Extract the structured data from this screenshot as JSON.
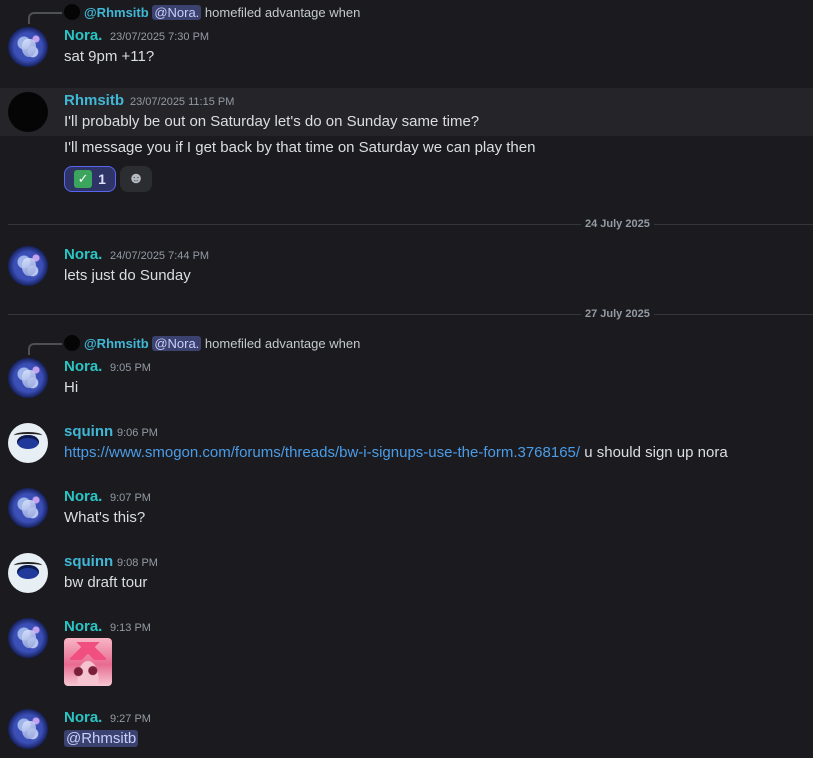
{
  "messages": {
    "m1": {
      "reply_user": "@Rhmsitb",
      "reply_mention": "@Nora.",
      "reply_text": " homefiled advantage when",
      "author": "Nora.",
      "time": "23/07/2025 7:30 PM",
      "text": "sat 9pm +11?"
    },
    "m2": {
      "author": "Rhmsitb",
      "time": "23/07/2025 11:15 PM",
      "line1": "I'll probably be out on Saturday let's do on Sunday same time?",
      "line2": "I'll message you if I get back by that time on Saturday we can play then",
      "reaction_emoji": "✓",
      "reaction_count": "1",
      "add_reaction_icon": "smiley-add-icon"
    },
    "divider1": "24 July 2025",
    "m3": {
      "author": "Nora.",
      "time": "24/07/2025 7:44 PM",
      "text": "lets just do Sunday"
    },
    "divider2": "27 July 2025",
    "m4": {
      "reply_user": "@Rhmsitb",
      "reply_mention": "@Nora.",
      "reply_text": " homefiled advantage when",
      "author": "Nora.",
      "time": "9:05 PM",
      "text": "Hi"
    },
    "m5": {
      "author": "squinn",
      "time": "9:06 PM",
      "link": "https://www.smogon.com/forums/threads/bw-i-signups-use-the-form.3768165/",
      "text": " u should sign up nora"
    },
    "m6": {
      "author": "Nora.",
      "time": "9:07 PM",
      "text": "What's this?"
    },
    "m7": {
      "author": "squinn",
      "time": "9:08 PM",
      "text": "bw draft tour"
    },
    "m8": {
      "author": "Nora.",
      "time": "9:13 PM",
      "emoji_name": "pink-pokemon-emoji"
    },
    "m9": {
      "author": "Nora.",
      "time": "9:27 PM",
      "mention": "@Rhmsitb"
    }
  },
  "colors": {
    "background": "#1b1b1f",
    "nora_name": "#2bc4c4",
    "rhmsitb_name": "#41b7d6",
    "squinn_name": "#41b7d6",
    "link": "#4b9ce8",
    "mention_bg": "#3c4270"
  }
}
